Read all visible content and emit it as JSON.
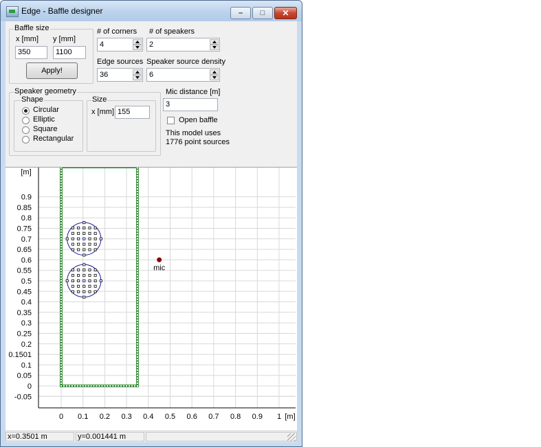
{
  "window": {
    "title": "Edge - Baffle designer"
  },
  "baffle_size": {
    "label": "Baffle size",
    "x_label": "x [mm]",
    "y_label": "y [mm]",
    "x_value": "350",
    "y_value": "1100",
    "apply_label": "Apply!"
  },
  "corners": {
    "label": "# of corners",
    "value": "4"
  },
  "speakers": {
    "label": "# of speakers",
    "value": "2"
  },
  "edge_sources": {
    "label": "Edge sources",
    "value": "36"
  },
  "density": {
    "label": "Speaker source density",
    "value": "6"
  },
  "geometry": {
    "label": "Speaker geometry",
    "shape_label": "Shape",
    "options": [
      {
        "label": "Circular",
        "selected": true
      },
      {
        "label": "Elliptic",
        "selected": false
      },
      {
        "label": "Square",
        "selected": false
      },
      {
        "label": "Rectangular",
        "selected": false
      }
    ],
    "size_label": "Size",
    "size_x_label": "x [mm]",
    "size_x_value": "155"
  },
  "mic": {
    "label": "Mic distance [m]",
    "value": "3"
  },
  "open_baffle": {
    "label": "Open baffle",
    "checked": false
  },
  "model_info": {
    "line1": "This model uses",
    "line2": "1776 point sources"
  },
  "status": {
    "x": "x=0.3501 m",
    "y": "y=0.001441 m"
  },
  "chart_data": {
    "type": "scatter",
    "ylabel": "[m]",
    "xlabel": "[m]",
    "xlim": [
      -0.1,
      1.05
    ],
    "ylim": [
      -0.1,
      1.0
    ],
    "x_ticks": [
      "0",
      "0.1",
      "0.2",
      "0.3",
      "0.4",
      "0.5",
      "0.6",
      "0.7",
      "0.8",
      "0.9",
      "1"
    ],
    "y_ticks": [
      "-0.05",
      "0",
      "0.05",
      "0.1",
      "0.1501",
      "0.2",
      "0.25",
      "0.3",
      "0.35",
      "0.4",
      "0.45",
      "0.5",
      "0.55",
      "0.6",
      "0.65",
      "0.7",
      "0.75",
      "0.8",
      "0.85",
      "0.9"
    ],
    "grid": true,
    "baffle": {
      "width": 0.35,
      "height": 1.1,
      "color": "#1a7a1a"
    },
    "speakers": [
      {
        "cx": 0.105,
        "cy": 0.7,
        "d": 0.155,
        "color": "#1a1aa0"
      },
      {
        "cx": 0.105,
        "cy": 0.5,
        "d": 0.155,
        "color": "#1a1aa0"
      }
    ],
    "mic": {
      "x": 0.45,
      "y": 0.6,
      "label": "mic",
      "color": "#8b0000"
    }
  }
}
